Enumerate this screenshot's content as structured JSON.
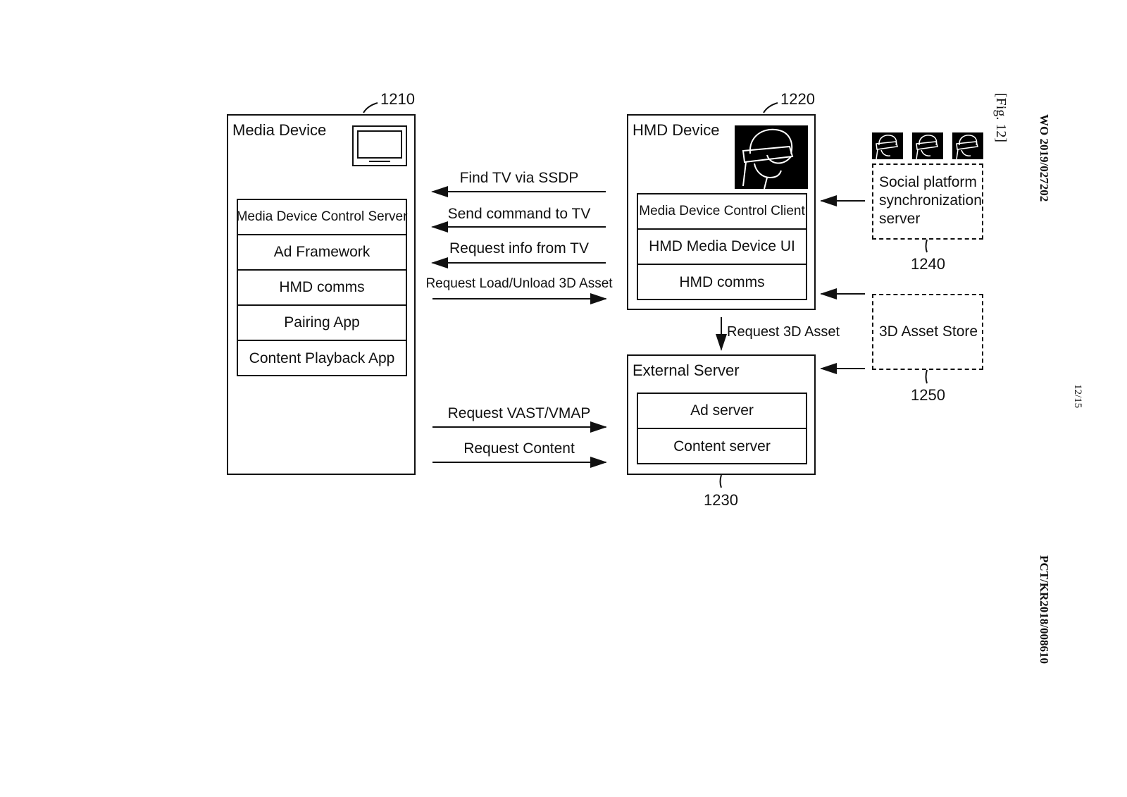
{
  "figure": {
    "fig_label": "[Fig. 12]",
    "publication_number": "WO 2019/027202",
    "application_number": "PCT/KR2018/008610",
    "sheet": "12/15"
  },
  "media_device": {
    "ref": "1210",
    "title": "Media Device",
    "icon": "tv-icon",
    "modules": [
      "Media Device Control Server",
      "Ad Framework",
      "HMD comms",
      "Pairing App",
      "Content Playback App"
    ]
  },
  "hmd_device": {
    "ref": "1220",
    "title": "HMD Device",
    "icon": "hmd-headset-icon",
    "modules": [
      "Media Device Control Client",
      "HMD Media Device UI",
      "HMD comms"
    ]
  },
  "external_server": {
    "ref": "1230",
    "title": "External Server",
    "modules": [
      "Ad server",
      "Content server"
    ]
  },
  "social_server": {
    "ref": "1240",
    "title_lines": [
      "Social platform",
      "synchronization",
      "server"
    ],
    "icons": [
      "hmd-user-icon",
      "hmd-user-icon",
      "hmd-user-icon"
    ]
  },
  "asset_store": {
    "ref": "1250",
    "title": "3D Asset Store"
  },
  "messages": {
    "hmd_to_media": [
      {
        "label": "Find TV via SSDP",
        "direction": "left"
      },
      {
        "label": "Send command to TV",
        "direction": "left"
      },
      {
        "label": "Request info from TV",
        "direction": "left"
      },
      {
        "label": "Request Load/Unload 3D Asset",
        "direction": "right"
      }
    ],
    "media_to_external": [
      {
        "label": "Request VAST/VMAP",
        "direction": "right"
      },
      {
        "label": "Request Content",
        "direction": "right"
      }
    ],
    "hmd_to_external": {
      "label": "Request 3D Asset",
      "direction": "down"
    }
  }
}
